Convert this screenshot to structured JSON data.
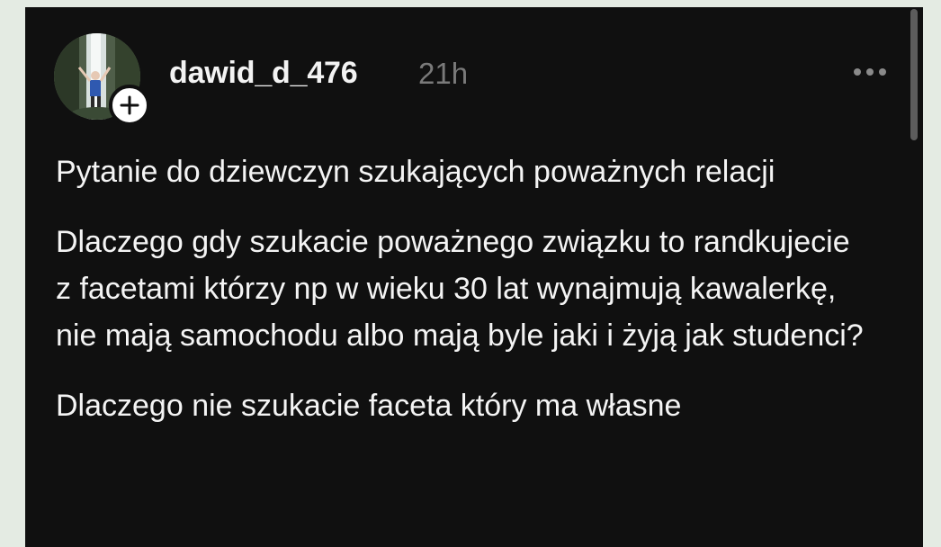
{
  "post": {
    "author": {
      "username": "dawid_d_476",
      "avatar_icon": "profile-photo",
      "follow_icon": "plus-icon"
    },
    "timestamp": "21h",
    "menu_icon": "more-horizontal-icon",
    "paragraphs": [
      "Pytanie do dziewczyn szukających poważnych relacji",
      "Dlaczego gdy szukacie poważnego związku to randkujecie z facetami którzy np w wieku 30 lat wynajmują kawalerkę, nie mają samochodu albo mają byle jaki i żyją jak studenci?",
      "Dlaczego nie szukacie faceta który ma własne"
    ]
  },
  "colors": {
    "background": "#e4ebe3",
    "card": "#101010",
    "text": "#f4f4f4",
    "muted": "#7a7a7a"
  }
}
